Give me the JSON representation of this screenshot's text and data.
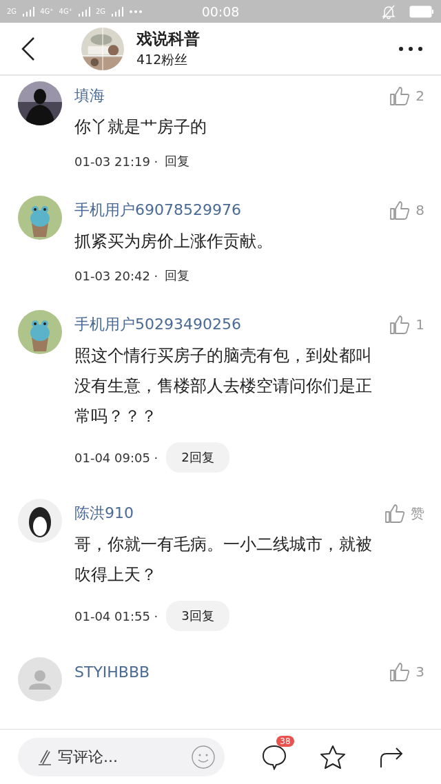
{
  "status_bar": {
    "time": "00:08",
    "signal_labels": [
      "2G",
      "4G⁺",
      "4G⁺",
      "2G"
    ]
  },
  "header": {
    "title": "戏说科普",
    "subtitle": "412粉丝"
  },
  "comments": [
    {
      "user": "填海",
      "likes": "2",
      "text": "你丫就是艹房子的",
      "time": "01-03 21:19 ·",
      "reply": {
        "kind": "link",
        "label": "回复"
      }
    },
    {
      "user": "手机用户69078529976",
      "avatar": {
        "kind": "cartoon"
      },
      "likes": "8",
      "text": "抓紧买为房价上涨作贡献。",
      "time": "01-03 20:42 ·",
      "reply": {
        "kind": "link",
        "label": "回复"
      }
    },
    {
      "user": "手机用户50293490256",
      "avatar": {
        "kind": "cartoon"
      },
      "likes": "1",
      "text": "照这个情行买房子的脑壳有包，到处都叫没有生意，售楼部人去楼空请问你们是正常吗？？？",
      "time": "01-04 09:05 ·",
      "reply": {
        "kind": "pill",
        "label": "2回复"
      }
    },
    {
      "user": "陈洪910",
      "avatar": {
        "kind": "plain"
      },
      "likes": "赞",
      "text": "哥，你就一有毛病。一小二线城市，就被吹得上天？",
      "time": "01-04 01:55 ·",
      "reply": {
        "kind": "pill",
        "label": "3回复"
      }
    },
    {
      "user": "STYIHBBB",
      "avatar": {
        "kind": "default"
      },
      "likes": "3"
    }
  ],
  "bottom_bar": {
    "placeholder": "写评论...",
    "comment_count": "38"
  }
}
